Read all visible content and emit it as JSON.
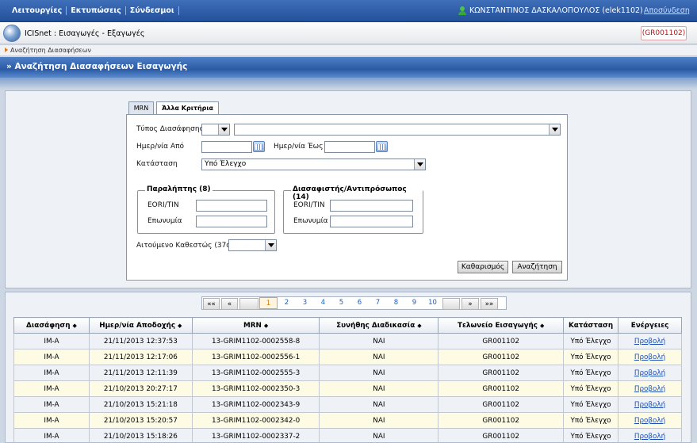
{
  "topbar": {
    "menu": [
      "Λειτουργίες",
      "Εκτυπώσεις",
      "Σύνδεσμοι"
    ],
    "user": "ΚΩΝΣΤΑΝΤΙΝΟΣ ΔΑΣΚΑΛΟΠΟΥΛΟΣ (elek1102)",
    "logout": "Αποσύνδεση"
  },
  "app": {
    "title": "ICISnet : Εισαγωγές - Εξαγωγές",
    "office": "(GR001102)"
  },
  "breadcrumb": "Αναζήτηση Διασαφήσεων",
  "section_title": "» Αναζήτηση Διασαφήσεων Εισαγωγής",
  "tabs": [
    "MRN",
    "Άλλα Κριτήρια"
  ],
  "form": {
    "type_label": "Τύπος Διασάφησης",
    "date_from_label": "Ημερ/νία Από",
    "date_to_label": "Ημερ/νία Έως",
    "status_label": "Κατάσταση",
    "status_value": "Υπό Έλεγχο",
    "consignee_legend": "Παραλήπτης (8)",
    "declarant_legend": "Διασαφιστής/Αντιπρόσωπος (14)",
    "eori_label": "EORI/TIN",
    "name_label": "Επωνυμία",
    "regime_label": "Αιτούμενο Καθεστώς (37α)",
    "clear_button": "Καθαρισμός",
    "search_button": "Αναζήτηση"
  },
  "pager": {
    "first": "««",
    "prev": "«",
    "pages": [
      "1",
      "2",
      "3",
      "4",
      "5",
      "6",
      "7",
      "8",
      "9",
      "10"
    ],
    "next": "»",
    "last": "»»"
  },
  "table": {
    "columns": [
      "Διασάφηση",
      "Ημερ/νία Αποδοχής",
      "MRN",
      "Συνήθης Διαδικασία",
      "Τελωνείο Εισαγωγής",
      "Κατάσταση",
      "Ενέργειες"
    ],
    "rows": [
      [
        "IM-A",
        "21/11/2013 12:37:53",
        "13-GRIM1102-0002558-8",
        "NAI",
        "GR001102",
        "Υπό Έλεγχο",
        "Προβολή"
      ],
      [
        "IM-A",
        "21/11/2013 12:17:06",
        "13-GRIM1102-0002556-1",
        "NAI",
        "GR001102",
        "Υπό Έλεγχο",
        "Προβολή"
      ],
      [
        "IM-A",
        "21/11/2013 12:11:39",
        "13-GRIM1102-0002555-3",
        "NAI",
        "GR001102",
        "Υπό Έλεγχο",
        "Προβολή"
      ],
      [
        "IM-A",
        "21/10/2013 20:27:17",
        "13-GRIM1102-0002350-3",
        "NAI",
        "GR001102",
        "Υπό Έλεγχο",
        "Προβολή"
      ],
      [
        "IM-A",
        "21/10/2013 15:21:18",
        "13-GRIM1102-0002343-9",
        "NAI",
        "GR001102",
        "Υπό Έλεγχο",
        "Προβολή"
      ],
      [
        "IM-A",
        "21/10/2013 15:20:57",
        "13-GRIM1102-0002342-0",
        "NAI",
        "GR001102",
        "Υπό Έλεγχο",
        "Προβολή"
      ],
      [
        "IM-A",
        "21/10/2013 15:18:26",
        "13-GRIM1102-0002337-2",
        "NAI",
        "GR001102",
        "Υπό Έλεγχο",
        "Προβολή"
      ]
    ]
  }
}
